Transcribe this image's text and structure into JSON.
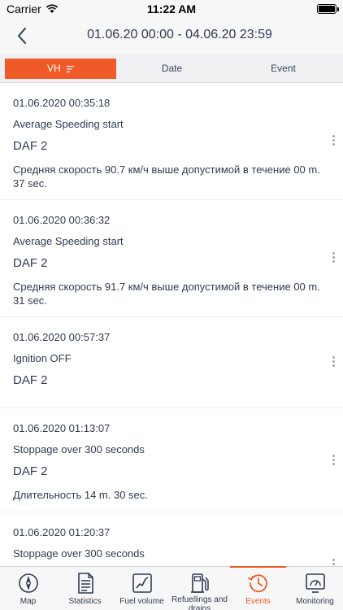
{
  "status_bar": {
    "carrier": "Carrier",
    "time": "11:22 AM"
  },
  "nav": {
    "title": "01.06.20 00:00 - 04.06.20 23:59"
  },
  "segments": [
    {
      "label": "VH",
      "active": true
    },
    {
      "label": "Date",
      "active": false
    },
    {
      "label": "Event",
      "active": false
    }
  ],
  "events": [
    {
      "date": "01.06.2020 00:35:18",
      "event": "Average Speeding start",
      "vehicle": "DAF 2",
      "desc": "Средняя скорость 90.7 км/ч выше допустимой в течение 00 m. 37 sec."
    },
    {
      "date": "01.06.2020 00:36:32",
      "event": "Average Speeding start",
      "vehicle": "DAF 2",
      "desc": "Средняя скорость 91.7 км/ч выше допустимой в течение 00 m. 31 sec."
    },
    {
      "date": "01.06.2020 00:57:37",
      "event": "Ignition OFF",
      "vehicle": "DAF 2",
      "desc": ""
    },
    {
      "date": "01.06.2020 01:13:07",
      "event": "Stoppage over 300 seconds",
      "vehicle": "DAF 2",
      "desc": "Длительность 14 m. 30 sec."
    },
    {
      "date": "01.06.2020 01:20:37",
      "event": "Stoppage over 300 seconds",
      "vehicle": "",
      "desc": ""
    }
  ],
  "tab_bar": [
    {
      "label": "Map",
      "icon": "compass-icon"
    },
    {
      "label": "Statistics",
      "icon": "document-icon"
    },
    {
      "label": "Fuel volume",
      "icon": "chart-icon"
    },
    {
      "label": "Refuellings and drains",
      "icon": "fuel-pump-icon"
    },
    {
      "label": "Events",
      "icon": "clock-history-icon",
      "active": true
    },
    {
      "label": "Monitoring",
      "icon": "monitor-icon"
    }
  ],
  "colors": {
    "accent": "#f05a28",
    "text": "#2f3b52"
  }
}
